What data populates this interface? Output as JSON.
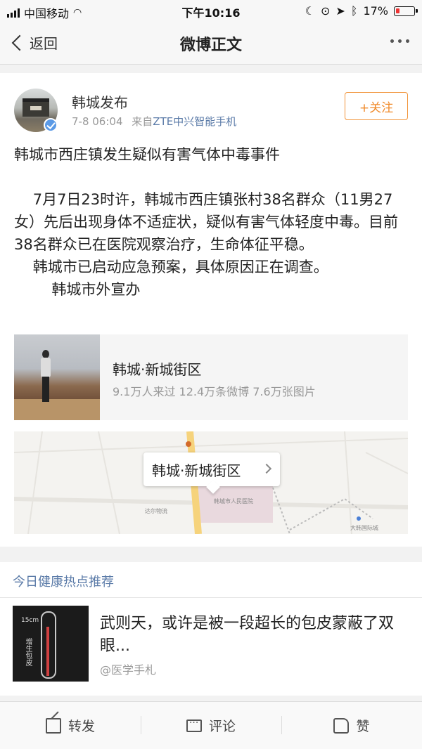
{
  "status_bar": {
    "carrier": "中国移动",
    "time": "下午10:16",
    "battery": "17%",
    "battery_color": "#e33333"
  },
  "nav": {
    "back_label": "返回",
    "title": "微博正文"
  },
  "post": {
    "author": "韩城发布",
    "time": "7-8 06:04",
    "source_prefix": "来自",
    "source": "ZTE中兴智能手机",
    "follow_label": "+关注",
    "paragraphs": [
      "韩城市西庄镇发生疑似有害气体中毒事件",
      "",
      "    7月7日23时许，韩城市西庄镇张村38名群众（11男27女）先后出现身体不适症状，疑似有害气体轻度中毒。目前38名群众已在医院观察治疗，生命体征平稳。",
      "    韩城市已启动应急预案，具体原因正在调查。",
      "        韩城市外宣办"
    ],
    "location": {
      "name": "韩城·新城街区",
      "stats": "9.1万人来过 12.4万条微博 7.6万张图片"
    },
    "map": {
      "pill_label": "韩城·新城街区",
      "labels": [
        "韩城市人民医院",
        "达尔物流",
        "大韩国际城"
      ]
    }
  },
  "recommend": {
    "header": "今日健康热点推荐",
    "title": "武则天，或许是被一段超长的包皮蒙蔽了双眼...",
    "source": "@医学手札",
    "img_text_1": "15cm",
    "img_text_2": "增生包皮"
  },
  "bottom_bar": {
    "share": "转发",
    "comment": "评论",
    "like": "赞"
  }
}
